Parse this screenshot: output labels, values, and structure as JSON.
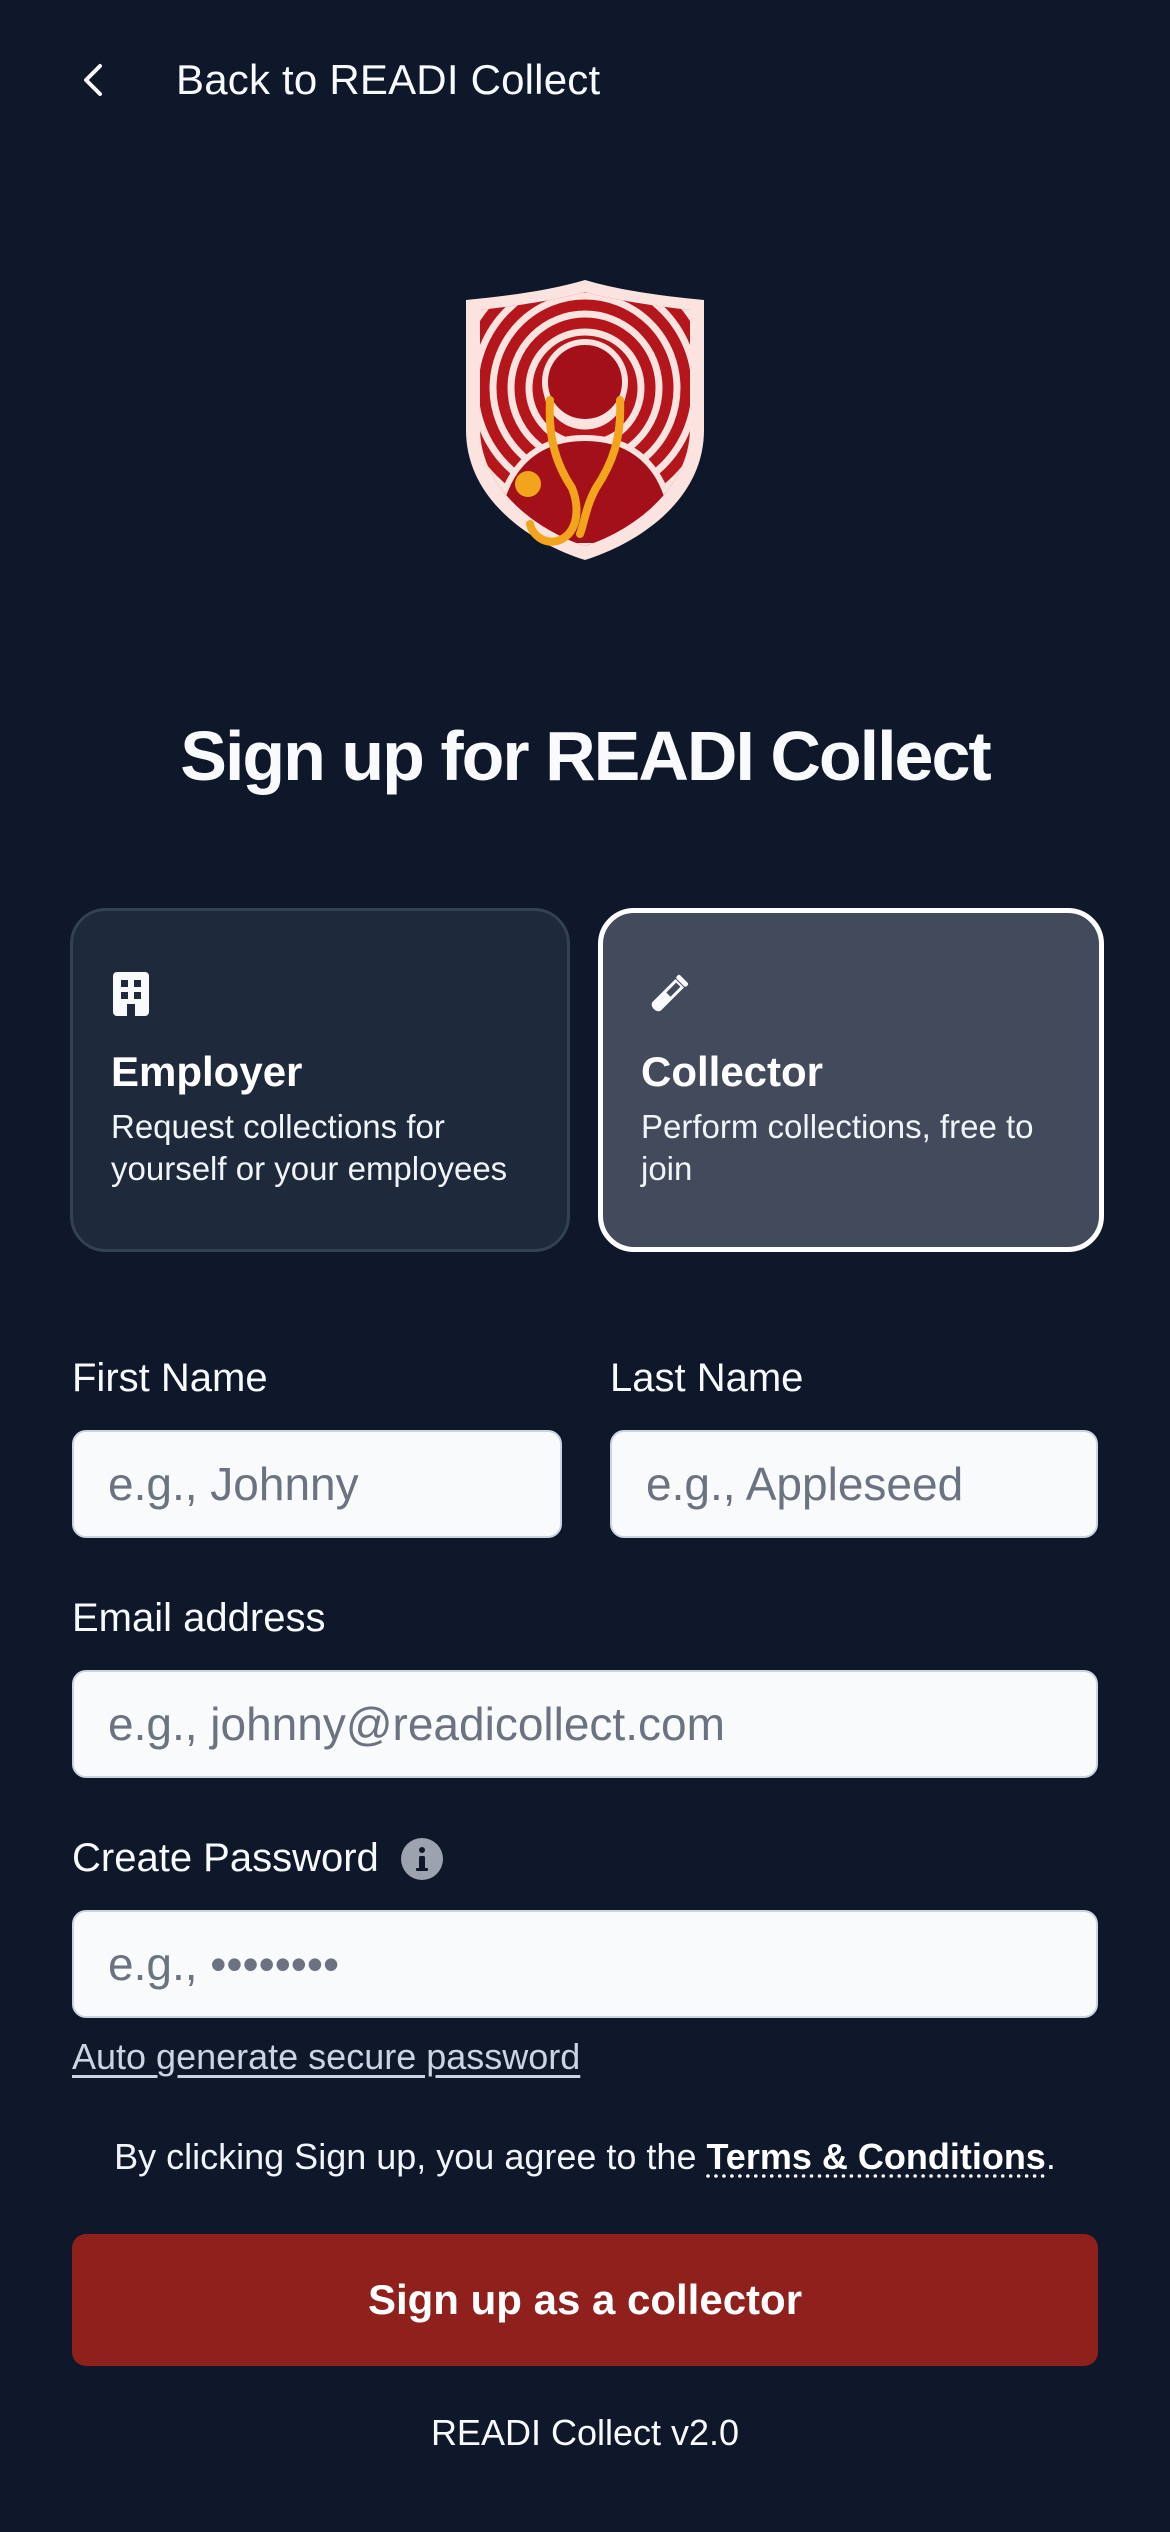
{
  "header": {
    "back_label": "Back to READI Collect",
    "back_icon": "chevron-left-icon"
  },
  "logo": {
    "icon": "shield-doctor-stethoscope-logo",
    "colors": {
      "shield_outer": "#fce7e5",
      "shield_inner": "#b91c1c",
      "stethoscope": "#f59e0b"
    }
  },
  "title": "Sign up for READI Collect",
  "roles": [
    {
      "id": "employer",
      "icon": "building-icon",
      "title": "Employer",
      "description": "Request collections for yourself or your employees",
      "selected": false
    },
    {
      "id": "collector",
      "icon": "test-tube-icon",
      "title": "Collector",
      "description": "Perform collections, free to join",
      "selected": true
    }
  ],
  "form": {
    "first_name": {
      "label": "First Name",
      "placeholder": "e.g., Johnny",
      "value": ""
    },
    "last_name": {
      "label": "Last Name",
      "placeholder": "e.g., Appleseed",
      "value": ""
    },
    "email": {
      "label": "Email address",
      "placeholder": "e.g., johnny@readicollect.com",
      "value": ""
    },
    "password": {
      "label": "Create Password",
      "placeholder": "e.g., ••••••••",
      "value": "",
      "info_icon": "info-icon"
    },
    "auto_generate_link": "Auto generate secure password"
  },
  "terms": {
    "prefix": "By clicking Sign up, you agree to the ",
    "link": "Terms & Conditions",
    "suffix": "."
  },
  "submit_label": "Sign up as a collector",
  "version": "READI Collect v2.0",
  "colors": {
    "background": "#0f172a",
    "card_default": "#1e293b",
    "card_selected": "#434a5b",
    "primary_button": "#8f201c"
  }
}
